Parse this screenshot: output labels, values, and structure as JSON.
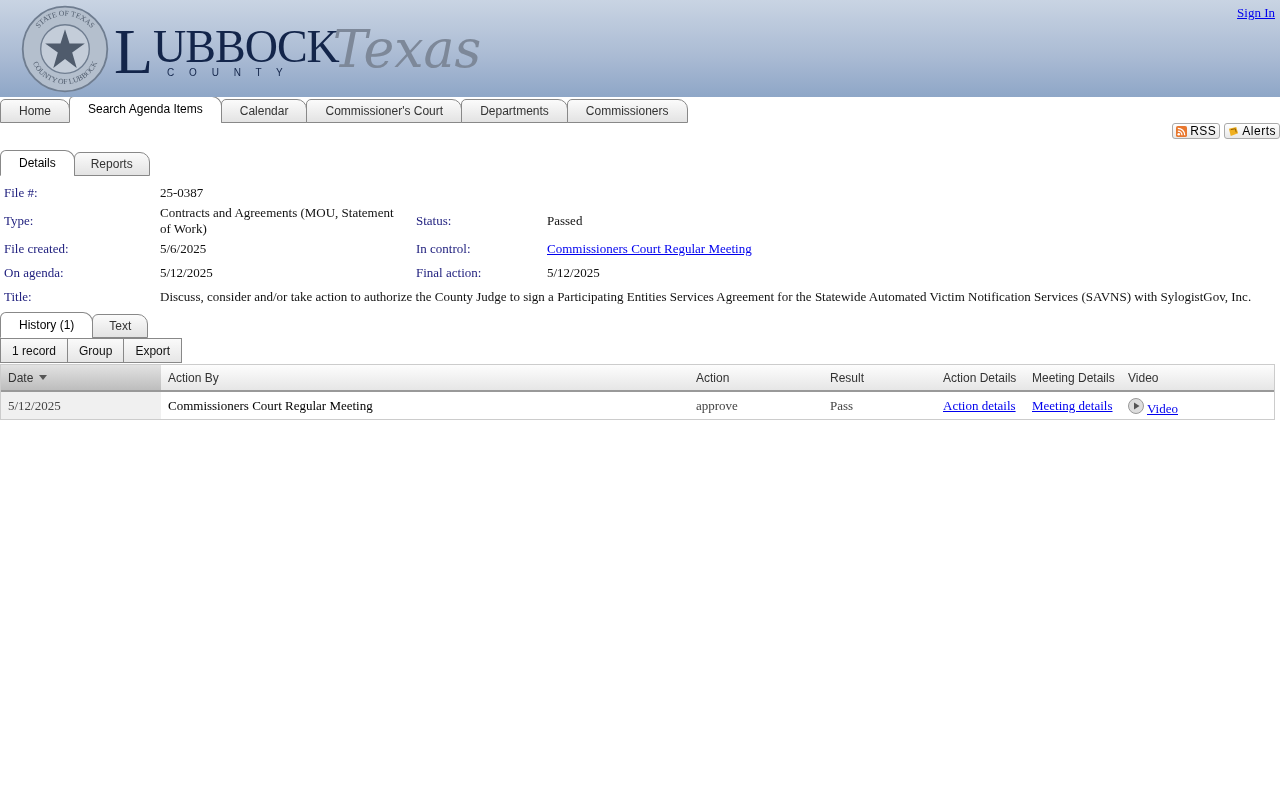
{
  "header": {
    "logo": {
      "seal_top": "STATE OF TEXAS",
      "seal_bottom": "COUNTY OF LUBBOCK",
      "initial": "L",
      "word": "UBBOCK",
      "subtitle": "C O U N T Y",
      "script": "Texas"
    },
    "sign_in": "Sign In"
  },
  "nav_tabs": [
    {
      "label": "Home",
      "selected": false
    },
    {
      "label": "Search Agenda Items",
      "selected": true
    },
    {
      "label": "Calendar",
      "selected": false
    },
    {
      "label": "Commissioner's Court",
      "selected": false
    },
    {
      "label": "Departments",
      "selected": false
    },
    {
      "label": "Commissioners",
      "selected": false
    }
  ],
  "feed_buttons": [
    {
      "label": "RSS",
      "kind": "rss"
    },
    {
      "label": "Alerts",
      "kind": "alerts"
    }
  ],
  "detail_tabs": [
    {
      "label": "Details",
      "selected": true
    },
    {
      "label": "Reports",
      "selected": false
    }
  ],
  "details": [
    {
      "cells": [
        {
          "label": "File #:",
          "value": "25-0387"
        }
      ]
    },
    {
      "cells": [
        {
          "label": "Type:",
          "value": "Contracts and Agreements (MOU, Statement of Work)"
        },
        {
          "label": "Status:",
          "value": "Passed"
        }
      ]
    },
    {
      "cells": [
        {
          "label": "File created:",
          "value": "5/6/2025"
        },
        {
          "label": "In control:",
          "value": "Commissioners Court Regular Meeting",
          "link": true
        }
      ]
    },
    {
      "cells": [
        {
          "label": "On agenda:",
          "value": "5/12/2025"
        },
        {
          "label": "Final action:",
          "value": "5/12/2025"
        }
      ]
    },
    {
      "cells": [
        {
          "label": "Title:",
          "value": "Discuss, consider and/or take action to authorize the County Judge to sign a Participating Entities Services Agreement for the Statewide Automated Victim Notification Services (SAVNS) with SylogistGov, Inc.",
          "wide": true
        }
      ]
    }
  ],
  "history_tabs": [
    {
      "label": "History (1)",
      "selected": true
    },
    {
      "label": "Text",
      "selected": false
    }
  ],
  "toolbar": [
    "1 record",
    "Group",
    "Export"
  ],
  "table": {
    "columns": [
      {
        "label": "Date",
        "sorted": true
      },
      {
        "label": "Action By",
        "sorted": false
      },
      {
        "label": "Action",
        "sorted": false
      },
      {
        "label": "Result",
        "sorted": false
      },
      {
        "label": "Action Details",
        "sorted": false
      },
      {
        "label": "Meeting Details",
        "sorted": false
      },
      {
        "label": "Video",
        "sorted": false
      }
    ],
    "rows": [
      {
        "cells": [
          {
            "text": "5/12/2025",
            "kind": "text"
          },
          {
            "text": "Commissioners Court Regular Meeting",
            "kind": "text"
          },
          {
            "text": "approve",
            "kind": "text"
          },
          {
            "text": "Pass",
            "kind": "text"
          },
          {
            "text": "Action details",
            "kind": "link"
          },
          {
            "text": "Meeting details",
            "kind": "link"
          },
          {
            "text": "Video",
            "kind": "video"
          }
        ]
      }
    ]
  }
}
